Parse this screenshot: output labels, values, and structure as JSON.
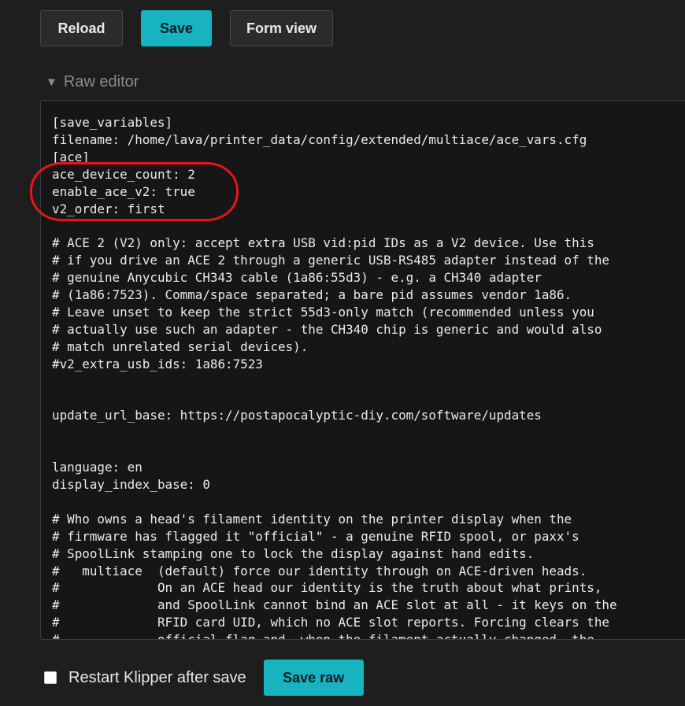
{
  "toolbar": {
    "reload_label": "Reload",
    "save_label": "Save",
    "form_view_label": "Form view"
  },
  "raw_editor": {
    "toggle_icon": "triangle-down-icon",
    "title": "Raw editor",
    "content": "[save_variables]\nfilename: /home/lava/printer_data/config/extended/multiace/ace_vars.cfg\n[ace]\nace_device_count: 2\nenable_ace_v2: true\nv2_order: first\n\n# ACE 2 (V2) only: accept extra USB vid:pid IDs as a V2 device. Use this\n# if you drive an ACE 2 through a generic USB-RS485 adapter instead of the\n# genuine Anycubic CH343 cable (1a86:55d3) - e.g. a CH340 adapter\n# (1a86:7523). Comma/space separated; a bare pid assumes vendor 1a86.\n# Leave unset to keep the strict 55d3-only match (recommended unless you\n# actually use such an adapter - the CH340 chip is generic and would also\n# match unrelated serial devices).\n#v2_extra_usb_ids: 1a86:7523\n\n\nupdate_url_base: https://postapocalyptic-diy.com/software/updates\n\n\nlanguage: en\ndisplay_index_base: 0\n\n# Who owns a head's filament identity on the printer display when the\n# firmware has flagged it \"official\" - a genuine RFID spool, or paxx's\n# SpoolLink stamping one to lock the display against hand edits.\n#   multiace  (default) force our identity through on ACE-driven heads.\n#             On an ACE head our identity is the truth about what prints,\n#             and SpoolLink cannot bind an ACE slot at all - it keys on the\n#             RFID card UID, which no ACE slot reports. Forcing clears the\n#             official flag and, when the filament actually changed, the"
  },
  "footer": {
    "restart_label": "Restart Klipper after save",
    "restart_checked": false,
    "save_raw_label": "Save raw"
  },
  "colors": {
    "background": "#1e1e1e",
    "accent": "#17b3c0",
    "annotation": "#e8141c"
  }
}
